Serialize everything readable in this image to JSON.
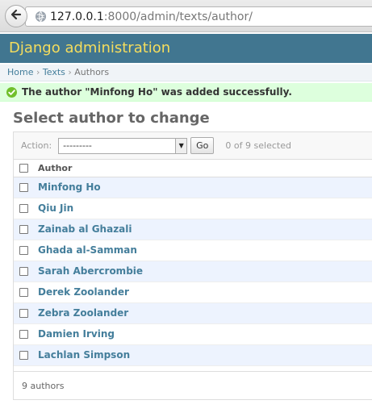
{
  "browser": {
    "url_host": "127.0.0.1",
    "url_rest": ":8000/admin/texts/author/"
  },
  "header": {
    "title": "Django administration"
  },
  "breadcrumbs": {
    "home": "Home",
    "sep": "›",
    "texts": "Texts",
    "current": "Authors"
  },
  "message": {
    "text": "The author \"Minfong Ho\" was added successfully."
  },
  "page_title": "Select author to change",
  "actions": {
    "label": "Action:",
    "selected_value": "---------",
    "go_label": "Go",
    "selected_count": "0 of 9 selected"
  },
  "table": {
    "column_header": "Author",
    "rows": [
      "Minfong Ho",
      "Qiu Jin",
      "Zainab al Ghazali",
      "Ghada al-Samman",
      "Sarah Abercrombie",
      "Derek Zoolander",
      "Zebra Zoolander",
      "Damien Irving",
      "Lachlan Simpson"
    ]
  },
  "paginator": {
    "text": "9 authors"
  },
  "colors": {
    "header_bg": "#417690",
    "header_title": "#f5dd5d",
    "link": "#447e9b",
    "success_bg": "#ddffdd",
    "row_alt": "#edf3fe"
  }
}
